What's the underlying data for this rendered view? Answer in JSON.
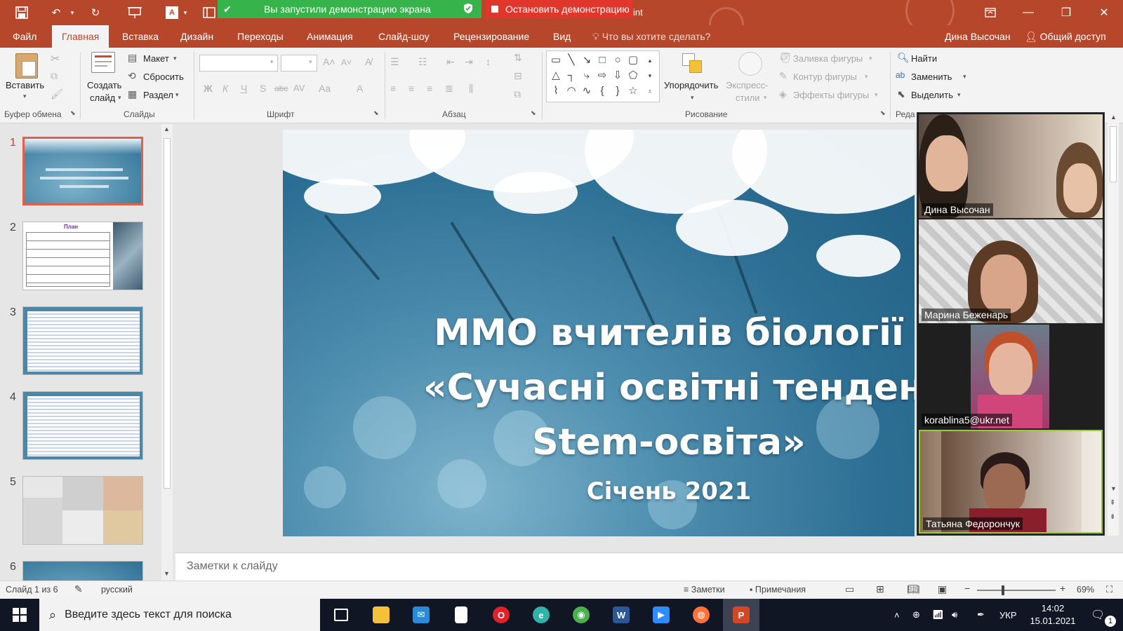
{
  "titlebar": {
    "share_banner": "Вы запустили демонстрацию экрана",
    "stop_button": "Остановить демонстрацию",
    "title_suffix": "int"
  },
  "tabs": [
    {
      "label": "Файл"
    },
    {
      "label": "Главная",
      "active": true
    },
    {
      "label": "Вставка"
    },
    {
      "label": "Дизайн"
    },
    {
      "label": "Переходы"
    },
    {
      "label": "Анимация"
    },
    {
      "label": "Слайд-шоу"
    },
    {
      "label": "Рецензирование"
    },
    {
      "label": "Вид"
    }
  ],
  "tell_me": "Что вы хотите сделать?",
  "user_name": "Дина Высочан",
  "share_label": "Общий доступ",
  "ribbon": {
    "clipboard": {
      "paste": "Вставить",
      "label": "Буфер обмена"
    },
    "slides": {
      "new_slide_1": "Создать",
      "new_slide_2": "слайд",
      "layout": "Макет",
      "reset": "Сбросить",
      "section": "Раздел",
      "label": "Слайды"
    },
    "font": {
      "label": "Шрифт",
      "bold": "Ж",
      "italic": "К",
      "underline": "Ч",
      "shadow": "S",
      "strike": "abc",
      "spacing": "AV",
      "case": "Aa",
      "color": "A"
    },
    "paragraph": {
      "label": "Абзац"
    },
    "drawing": {
      "arrange": "Упорядочить",
      "quick_styles_1": "Экспресс-",
      "quick_styles_2": "стили",
      "fill": "Заливка фигуры",
      "outline": "Контур фигуры",
      "effects": "Эффекты фигуры",
      "label": "Рисование"
    },
    "editing": {
      "find": "Найти",
      "replace": "Заменить",
      "select": "Выделить",
      "label": "Реда"
    }
  },
  "thumbnails": [
    {
      "number": "1",
      "active": true
    },
    {
      "number": "2",
      "title": "План"
    },
    {
      "number": "3"
    },
    {
      "number": "4"
    },
    {
      "number": "5"
    },
    {
      "number": "6"
    }
  ],
  "slide": {
    "line1": "ММО вчителів біології",
    "line2": "«Сучасні освітні тенденції:",
    "line3": "Stem-освіта»",
    "date": "Січень 2021"
  },
  "notes_placeholder": "Заметки к слайду",
  "status": {
    "slide_of": "Слайд 1 из 6",
    "language": "русский",
    "notes": "Заметки",
    "comments": "Примечания",
    "zoom": "69%"
  },
  "participants": [
    {
      "name": "Дина Высочан"
    },
    {
      "name": "Марина Беженарь"
    },
    {
      "name": "korablina5@ukr.net"
    },
    {
      "name": "Татьяна Федорончук",
      "active": true
    }
  ],
  "taskbar": {
    "search_placeholder": "Введите здесь текст для поиска",
    "language": "УКР",
    "time": "14:02",
    "date": "15.01.2021",
    "notification_count": "1",
    "apps": [
      {
        "icon": "task-view-icon",
        "color": "#ffffff"
      },
      {
        "icon": "file-explorer-icon",
        "color": "#f3c13a"
      },
      {
        "icon": "mail-icon",
        "color": "#2a8ad8"
      },
      {
        "icon": "notepad-icon",
        "color": "#ffffff"
      },
      {
        "icon": "opera-icon",
        "color": "#e0202a"
      },
      {
        "icon": "edge-icon",
        "color": "#2fb3a6"
      },
      {
        "icon": "chrome-icon",
        "color": "#4caf50"
      },
      {
        "icon": "word-icon",
        "color": "#2b5797"
      },
      {
        "icon": "zoom-icon",
        "color": "#2d8cff"
      },
      {
        "icon": "firefox-icon",
        "color": "#ff7139"
      },
      {
        "icon": "powerpoint-icon",
        "color": "#d24726"
      }
    ]
  },
  "colors": {
    "accent": "#b7472a",
    "share_green": "#36b34a",
    "stop_red": "#e0362c",
    "taskbar": "#101623"
  }
}
